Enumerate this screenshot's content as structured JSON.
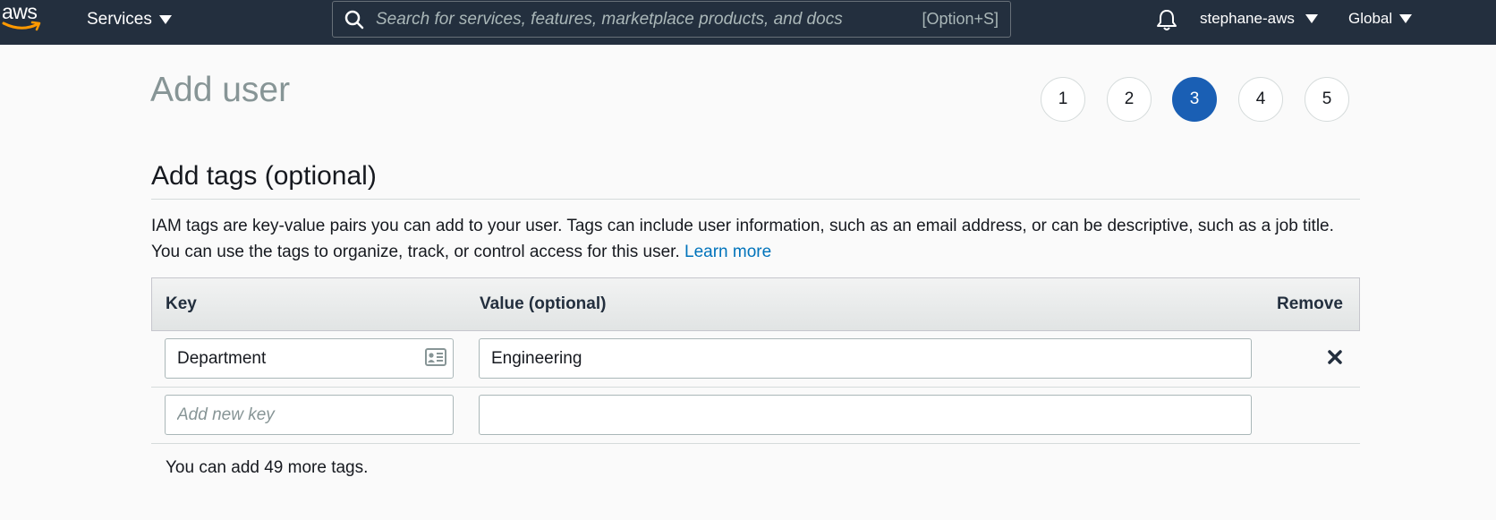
{
  "nav": {
    "logo_text": "aws",
    "services_label": "Services",
    "search_placeholder": "Search for services, features, marketplace products, and docs",
    "search_shortcut": "[Option+S]",
    "account_name": "stephane-aws",
    "region_label": "Global",
    "icons": {
      "search": "search-icon",
      "notifications": "bell-icon",
      "dropdown": "caret-down-icon"
    }
  },
  "page": {
    "title": "Add user",
    "steps": [
      {
        "label": "1",
        "active": false
      },
      {
        "label": "2",
        "active": false
      },
      {
        "label": "3",
        "active": true
      },
      {
        "label": "4",
        "active": false
      },
      {
        "label": "5",
        "active": false
      }
    ]
  },
  "section": {
    "title": "Add tags (optional)",
    "description": "IAM tags are key-value pairs you can add to your user. Tags can include user information, such as an email address, or can be descriptive, such as a job title. You can use the tags to organize, track, or control access for this user.",
    "learn_more": "Learn more"
  },
  "tags_table": {
    "headers": {
      "key": "Key",
      "value": "Value (optional)",
      "remove": "Remove"
    },
    "rows": [
      {
        "key": "Department",
        "value": "Engineering"
      }
    ],
    "new_row": {
      "key_placeholder": "Add new key",
      "value_placeholder": ""
    },
    "remaining_note": "You can add 49 more tags."
  },
  "colors": {
    "nav_background": "#232f3e",
    "active_step": "#1a5fb4",
    "link": "#0073bb"
  }
}
